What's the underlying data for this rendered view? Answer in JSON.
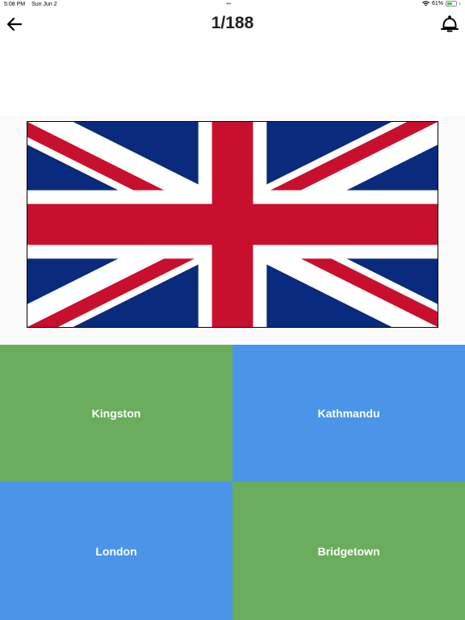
{
  "status_bar": {
    "time": "5:08 PM",
    "date": "Sun Jun 2",
    "battery_text": "61%",
    "battery_level": 0.61,
    "icons": [
      "wifi-icon",
      "battery-icon",
      "charging-icon"
    ]
  },
  "nav": {
    "title": "1/188",
    "back_icon": "arrow-left-icon",
    "notification_icon": "bell-icon"
  },
  "flag": {
    "country": "united-kingdom",
    "colors": {
      "blue": "#0a2a7d",
      "red": "#c8102e",
      "white": "#ffffff"
    }
  },
  "answers": [
    {
      "label": "Kingston",
      "color": "#6aad5c"
    },
    {
      "label": "Kathmandu",
      "color": "#4a95e8"
    },
    {
      "label": "London",
      "color": "#4a95e8"
    },
    {
      "label": "Bridgetown",
      "color": "#6aad5c"
    }
  ]
}
